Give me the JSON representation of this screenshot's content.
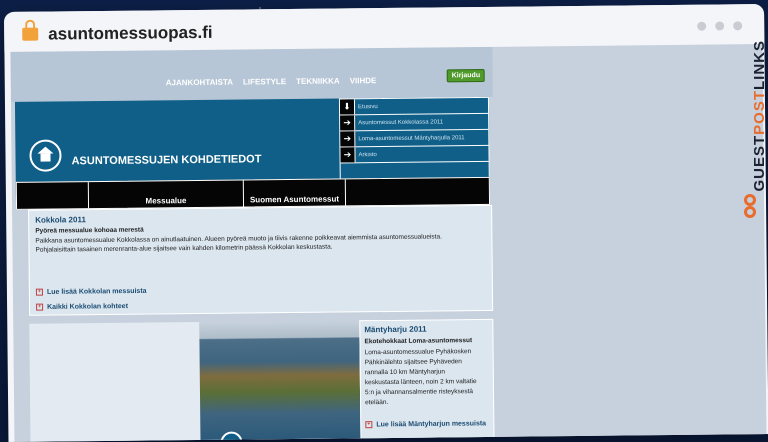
{
  "browser": {
    "url": "asuntomessuopas.fi"
  },
  "site": {
    "nav": [
      "AJANKOHTAISTA",
      "LIFESTYLE",
      "TEKNIIKKA",
      "VIIHDE"
    ],
    "login": "Kirjaudu",
    "banner_title": "ASUNTOMESSUJEN KOHDETIEDOT",
    "menu": [
      "Etusivu",
      "Asuntomessut Kokkolassa 2011",
      "Loma-asuntomessut Mäntyharjulla 2011",
      "Arkisto"
    ],
    "columns": [
      "",
      "Messualue",
      "Suomen Asuntomessut",
      ""
    ],
    "kokkola": {
      "title": "Kokkola 2011",
      "subtitle": "Pyöreä messualue kohoaa merestä",
      "p1": "Paikkana asuntomessualue Kokkolassa on ainutlaatuinen. Alueen pyöreä muoto ja tiivis rakenne poikkeavat aiemmista asuntomessualueista.",
      "p2": "Pohjalaisittain tasainen merenranta-alue sijaitsee vain kahden kilometrin päässä Kokkolan keskustasta.",
      "link1": "Lue lisää Kokkolan messuista",
      "link2": "Kaikki Kokkolan kohteet"
    },
    "mantyharju": {
      "title": "Mäntyharju 2011",
      "subtitle": "Ekotehokkaat Loma-asuntomessut",
      "lines": [
        "Loma-asuntomessualue Pyhäkosken",
        "Pähkinälehto sijaitsee Pyhäveden",
        "rannalla 10 km Mäntyharjun",
        "keskustasta länteen, noin 2 km valtatie",
        "5:n ja vihannansalmentie risteyksestä",
        "etelään."
      ],
      "link": "Lue lisää Mäntyharjun messuista"
    }
  },
  "brand": {
    "part1": "GUEST",
    "part2": "POST",
    "part3": "LINKS"
  }
}
